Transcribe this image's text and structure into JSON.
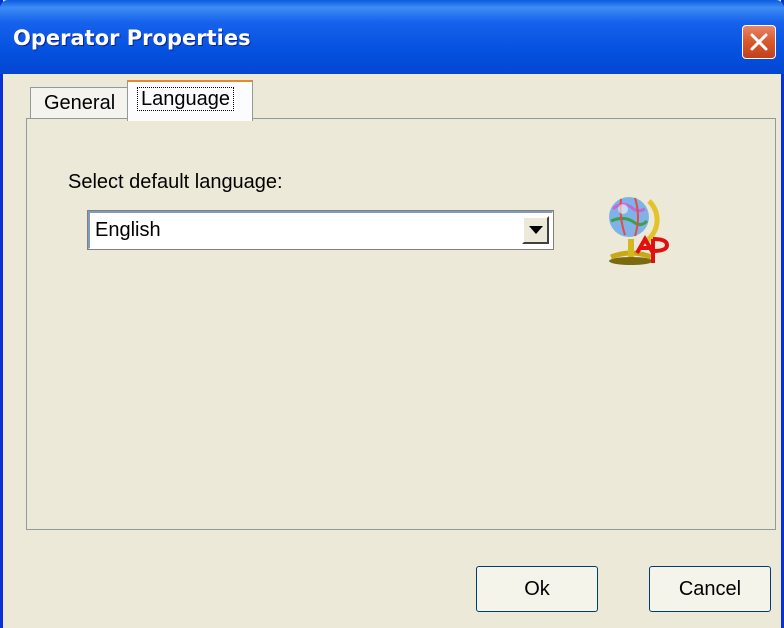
{
  "window": {
    "title": "Operator Properties"
  },
  "tabs": [
    {
      "label": "General",
      "selected": false
    },
    {
      "label": "Language",
      "selected": true
    }
  ],
  "language": {
    "prompt": "Select default language:",
    "selected": "English"
  },
  "buttons": {
    "ok": "Ok",
    "cancel": "Cancel"
  },
  "icons": {
    "close": "close-icon",
    "dropdown": "chevron-down-icon",
    "language": "globe-icon"
  },
  "colors": {
    "titlebar": "#0451E0",
    "close": "#D95B2F",
    "face": "#ECE9D8"
  }
}
